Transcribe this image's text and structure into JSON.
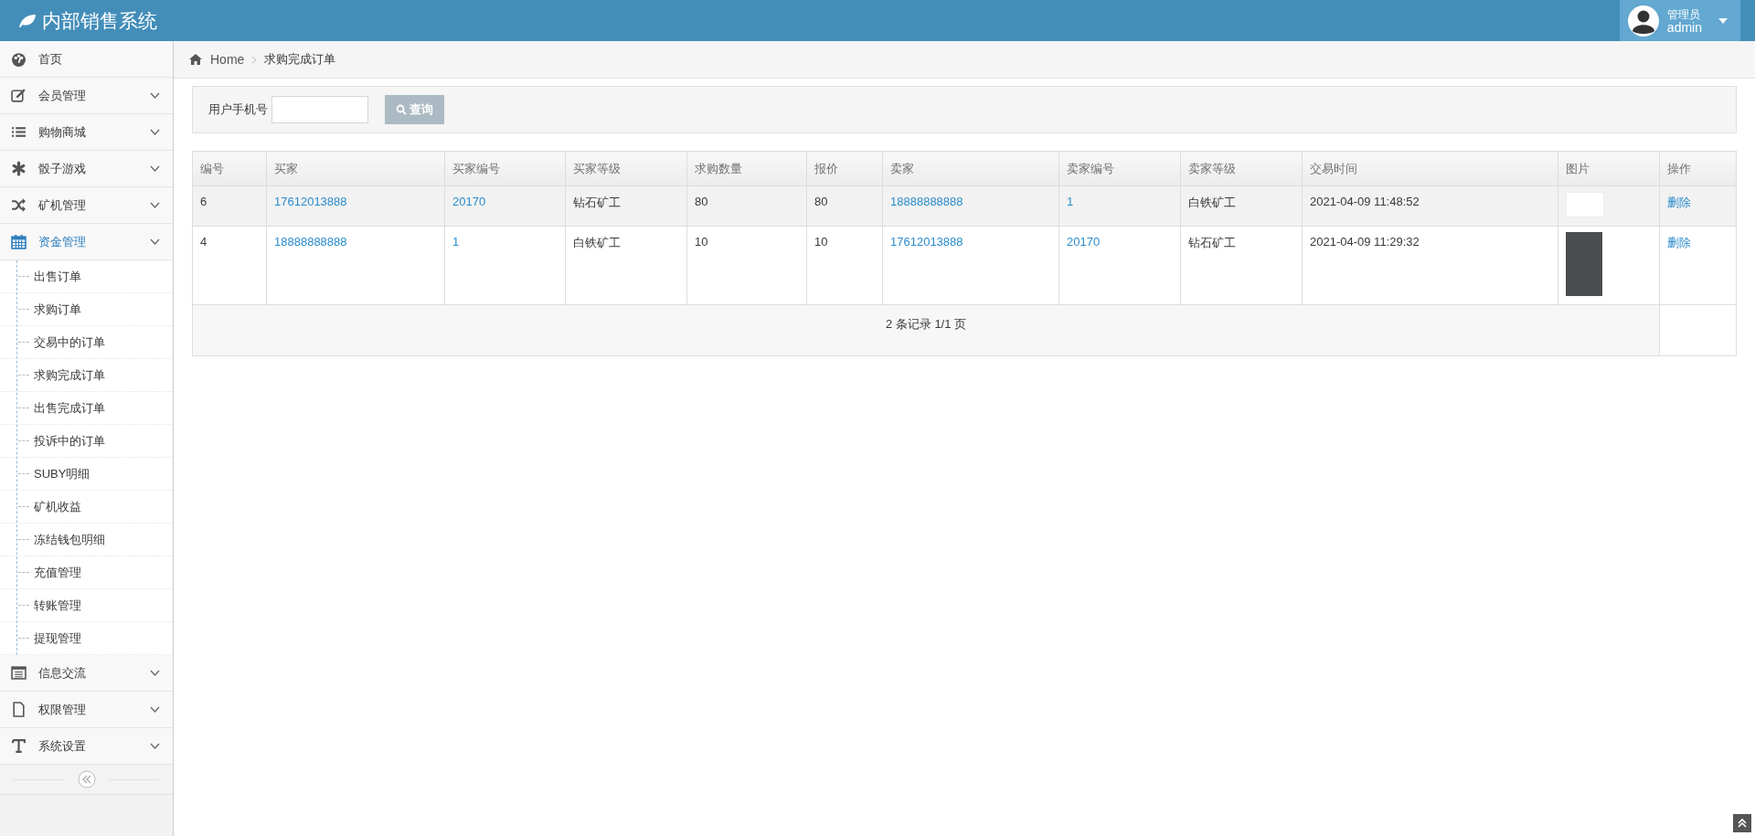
{
  "header": {
    "title": "内部销售系统",
    "user": {
      "role": "管理员",
      "name": "admin"
    }
  },
  "sidebar": {
    "items": [
      {
        "label": "首页",
        "kind": "link",
        "selected": false
      },
      {
        "label": "会员管理",
        "kind": "menu",
        "selected": false
      },
      {
        "label": "购物商城",
        "kind": "menu",
        "selected": false
      },
      {
        "label": "骰子游戏",
        "kind": "menu",
        "selected": false
      },
      {
        "label": "矿机管理",
        "kind": "menu",
        "selected": false
      },
      {
        "label": "资金管理",
        "kind": "menu",
        "selected": true,
        "children": [
          {
            "label": "出售订单",
            "selected": false
          },
          {
            "label": "求购订单",
            "selected": false
          },
          {
            "label": "交易中的订单",
            "selected": false
          },
          {
            "label": "求购完成订单",
            "selected": false
          },
          {
            "label": "出售完成订单",
            "selected": false
          },
          {
            "label": "投诉中的订单",
            "selected": false
          },
          {
            "label": "SUBY明细",
            "selected": false
          },
          {
            "label": "矿机收益",
            "selected": false
          },
          {
            "label": "冻结钱包明细",
            "selected": false
          },
          {
            "label": "充值管理",
            "selected": false
          },
          {
            "label": "转账管理",
            "selected": false
          },
          {
            "label": "提现管理",
            "selected": false
          }
        ]
      },
      {
        "label": "信息交流",
        "kind": "menu",
        "selected": false
      },
      {
        "label": "权限管理",
        "kind": "menu",
        "selected": false
      },
      {
        "label": "系统设置",
        "kind": "menu",
        "selected": false
      }
    ]
  },
  "breadcrumb": [
    "Home",
    "求购完成订单"
  ],
  "search": {
    "label": "用户手机号",
    "button": "查询"
  },
  "table": {
    "columns": [
      "编号",
      "买家",
      "买家编号",
      "买家等级",
      "求购数量",
      "报价",
      "卖家",
      "卖家编号",
      "卖家等级",
      "交易时间",
      "图片",
      "操作"
    ],
    "rows": [
      {
        "hovered": true,
        "cells": [
          "6",
          "17612013888",
          "20170",
          "钻石矿工",
          "80",
          "80",
          "18888888888",
          "1",
          "白铁矿工",
          "2021-04-09 11:48:52"
        ],
        "action": "删除"
      },
      {
        "hovered": false,
        "cells": [
          "4",
          "18888888888",
          "1",
          "白铁矿工",
          "10",
          "10",
          "17612013888",
          "20170",
          "钻石矿工",
          "2021-04-09 11:29:32"
        ],
        "action": "删除"
      }
    ],
    "footer": "2 条记录 1/1 页"
  }
}
